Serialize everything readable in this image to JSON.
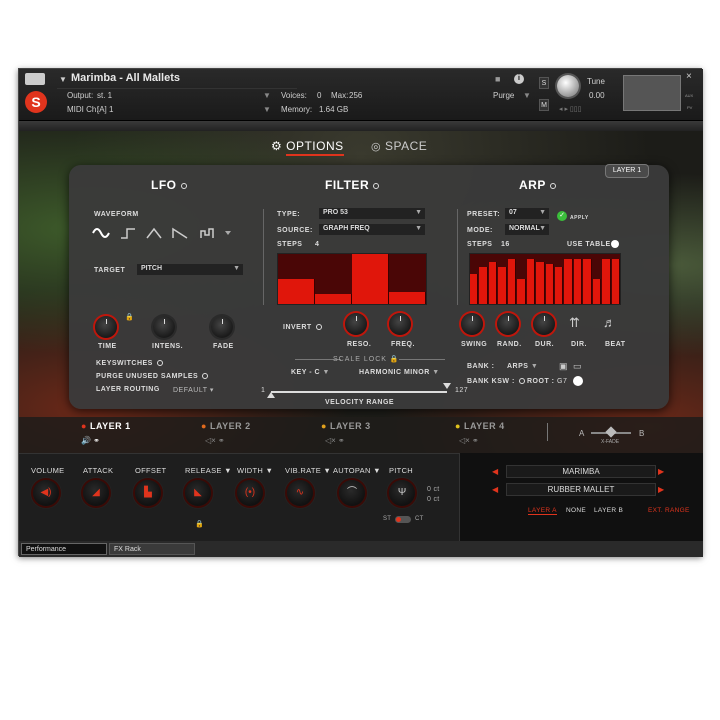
{
  "header": {
    "instrument_name": "Marimba - All Mallets",
    "output_label": "Output:",
    "output_value": "st. 1",
    "voices_label": "Voices:",
    "voices_value": "0",
    "max_label": "Max:",
    "max_value": "256",
    "midi_label": "MIDI Ch:",
    "midi_value": "[A] 1",
    "memory_label": "Memory:",
    "memory_value": "1.64 GB",
    "purge_label": "Purge",
    "tune_label": "Tune",
    "tune_value": "0.00",
    "s_label": "S",
    "m_label": "M",
    "close": "×",
    "aux_label": "AUX",
    "pv_label": "PV"
  },
  "top_tabs": {
    "options": "OPTIONS",
    "space": "SPACE"
  },
  "panel": {
    "layer_badge": "LAYER 1",
    "lfo": {
      "title": "LFO",
      "waveform_label": "WAVEFORM",
      "target_label": "TARGET",
      "target_value": "PITCH",
      "knobs": [
        "TIME",
        "INTENS.",
        "FADE"
      ],
      "keyswitches": "KEYSWITCHES",
      "purge_unused": "PURGE UNUSED SAMPLES",
      "layer_routing": "LAYER ROUTING",
      "layer_routing_value": "DEFAULT"
    },
    "filter": {
      "title": "FILTER",
      "type_label": "TYPE:",
      "type_value": "PRO 53",
      "source_label": "SOURCE:",
      "source_value": "GRAPH FREQ",
      "steps_label": "STEPS",
      "steps_value": "4",
      "step_levels": [
        0.5,
        0.2,
        1.0,
        0.25
      ],
      "invert": "INVERT",
      "knobs": [
        "RESO.",
        "FREQ."
      ],
      "scale_lock": "SCALE LOCK",
      "key_value": "KEY - C",
      "scale_value": "HARMONIC MINOR",
      "velocity_min": "1",
      "velocity_max": "127",
      "velocity_range": "VELOCITY RANGE"
    },
    "arp": {
      "title": "ARP",
      "preset_label": "PRESET:",
      "preset_value": "07",
      "apply": "APPLY",
      "mode_label": "MODE:",
      "mode_value": "NORMAL",
      "steps_label": "STEPS",
      "steps_value": "16",
      "use_table": "USE TABLE",
      "step_levels": [
        0.6,
        0.75,
        0.85,
        0.75,
        0.9,
        0.5,
        0.9,
        0.85,
        0.8,
        0.75,
        0.9,
        0.9,
        0.9,
        0.5,
        0.9,
        0.9
      ],
      "knobs": [
        "SWING",
        "RAND.",
        "DUR.",
        "DIR.",
        "BEAT"
      ],
      "bank_label": "BANK :",
      "bank_value": "ARPS",
      "bank_ksw": "BANK KSW :",
      "root_label": "ROOT :",
      "root_value": "G7"
    }
  },
  "layers": [
    {
      "label": "LAYER 1",
      "color": "#e0341d",
      "active": true
    },
    {
      "label": "LAYER 2",
      "color": "#e06a1d",
      "active": false
    },
    {
      "label": "LAYER 3",
      "color": "#e0a01d",
      "active": false
    },
    {
      "label": "LAYER 4",
      "color": "#e0c21d",
      "active": false
    }
  ],
  "xfade": {
    "a": "A",
    "label": "X-FADE",
    "b": "B"
  },
  "bottom_controls": [
    {
      "label": "VOLUME"
    },
    {
      "label": "ATTACK"
    },
    {
      "label": "OFFSET"
    },
    {
      "label": "RELEASE"
    },
    {
      "label": "WIDTH"
    },
    {
      "label": "VIB.RATE"
    },
    {
      "label": "AUTOPAN"
    },
    {
      "label": "PITCH"
    }
  ],
  "pitch_values": {
    "a": "0 ct",
    "b": "0 ct",
    "st": "ST",
    "ct": "CT"
  },
  "sample_select": {
    "instrument": "MARIMBA",
    "mallet": "RUBBER MALLET",
    "layer_a": "LAYER A",
    "none": "NONE",
    "layer_b": "LAYER B",
    "ext_range": "EXT. RANGE"
  },
  "bottom_tabs": [
    "Performance",
    "FX Rack"
  ],
  "colors": {
    "accent": "#e0341d",
    "panel": "#3a3a3a",
    "bar": "#e0160b"
  }
}
